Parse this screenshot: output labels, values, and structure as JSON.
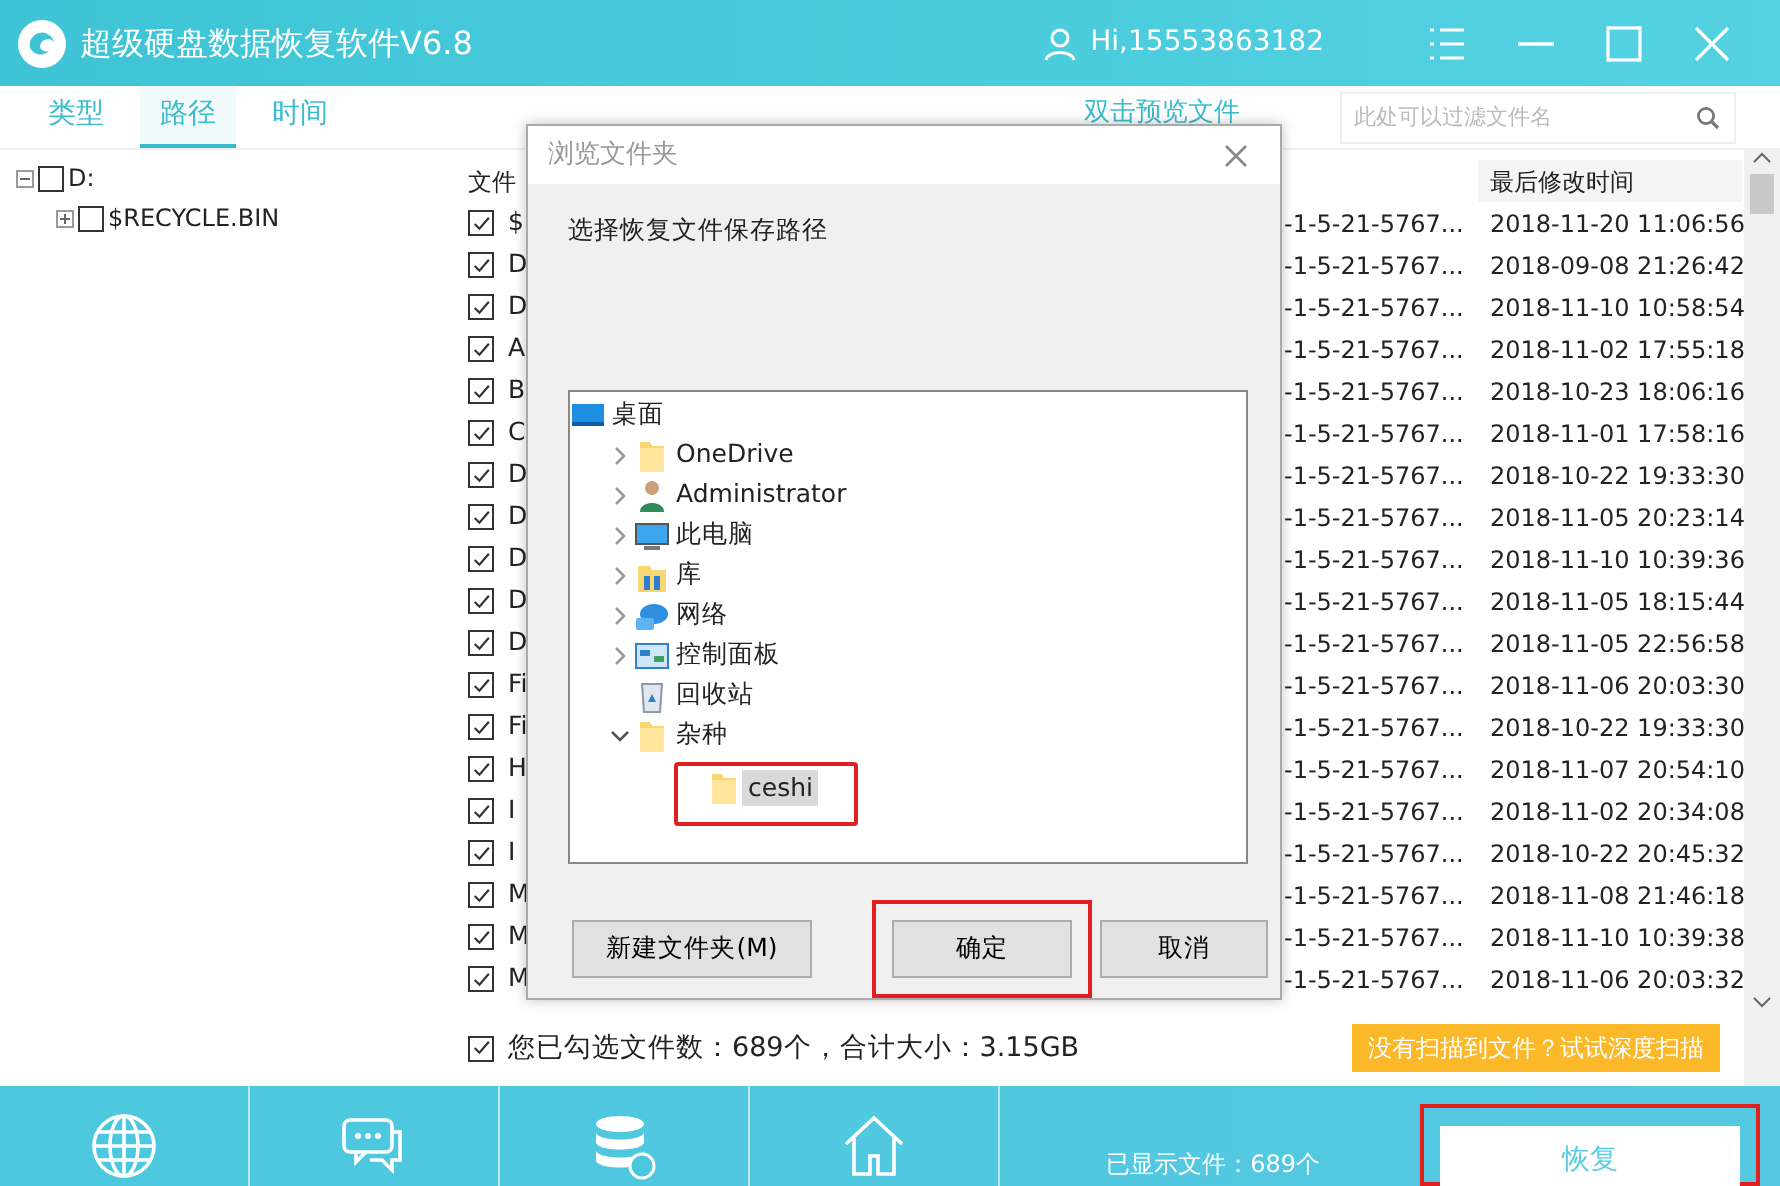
{
  "window": {
    "title": "超级硬盘数据恢复软件V6.8",
    "user": "Hi,15553863182"
  },
  "tabs": [
    {
      "label": "类型",
      "selected": false
    },
    {
      "label": "路径",
      "selected": true
    },
    {
      "label": "时间",
      "selected": false
    }
  ],
  "preview_hint": "双击预览文件",
  "search": {
    "placeholder": "此处可以过滤文件名"
  },
  "drive_tree": [
    {
      "label": "D:",
      "expanded": true,
      "checked": false,
      "children": [
        {
          "label": "$RECYCLE.BIN",
          "expanded": false,
          "checked": false
        }
      ]
    }
  ],
  "file_list": {
    "columns": [
      "文件",
      "最后修改时间"
    ],
    "rows": [
      {
        "name": "$",
        "path": "-1-5-21-5767...",
        "modified": "2018-11-20 11:06:56",
        "checked": true
      },
      {
        "name": "D",
        "path": "-1-5-21-5767...",
        "modified": "2018-09-08 21:26:42",
        "checked": true
      },
      {
        "name": "D",
        "path": "-1-5-21-5767...",
        "modified": "2018-11-10 10:58:54",
        "checked": true
      },
      {
        "name": "A",
        "path": "-1-5-21-5767...",
        "modified": "2018-11-02 17:55:18",
        "checked": true
      },
      {
        "name": "B",
        "path": "-1-5-21-5767...",
        "modified": "2018-10-23 18:06:16",
        "checked": true
      },
      {
        "name": "C",
        "path": "-1-5-21-5767...",
        "modified": "2018-11-01 17:58:16",
        "checked": true
      },
      {
        "name": "D",
        "path": "-1-5-21-5767...",
        "modified": "2018-10-22 19:33:30",
        "checked": true
      },
      {
        "name": "D",
        "path": "-1-5-21-5767...",
        "modified": "2018-11-05 20:23:14",
        "checked": true
      },
      {
        "name": "D",
        "path": "-1-5-21-5767...",
        "modified": "2018-11-10 10:39:36",
        "checked": true
      },
      {
        "name": "D",
        "path": "-1-5-21-5767...",
        "modified": "2018-11-05 18:15:44",
        "checked": true
      },
      {
        "name": "D",
        "path": "-1-5-21-5767...",
        "modified": "2018-11-05 22:56:58",
        "checked": true
      },
      {
        "name": "Fi",
        "path": "-1-5-21-5767...",
        "modified": "2018-11-06 20:03:30",
        "checked": true
      },
      {
        "name": "Fi",
        "path": "-1-5-21-5767...",
        "modified": "2018-10-22 19:33:30",
        "checked": true
      },
      {
        "name": "H",
        "path": "-1-5-21-5767...",
        "modified": "2018-11-07 20:54:10",
        "checked": true
      },
      {
        "name": "I",
        "path": "-1-5-21-5767...",
        "modified": "2018-11-02 20:34:08",
        "checked": true
      },
      {
        "name": "I",
        "path": "-1-5-21-5767...",
        "modified": "2018-10-22 20:45:32",
        "checked": true
      },
      {
        "name": "M",
        "path": "-1-5-21-5767...",
        "modified": "2018-11-08 21:46:18",
        "checked": true
      },
      {
        "name": "M",
        "path": "-1-5-21-5767...",
        "modified": "2018-11-10 10:39:38",
        "checked": true
      },
      {
        "name": "M",
        "path": "-1-5-21-5767...",
        "modified": "2018-11-06 20:03:32",
        "checked": true
      }
    ]
  },
  "summary": {
    "checked": true,
    "text": "您已勾选文件数：689个，合计大小：3.15GB"
  },
  "deep_scan_button": "没有扫描到文件？试试深度扫描",
  "footer": {
    "shown_count": "已显示文件：689个",
    "recover_button": {
      "label": "恢复",
      "highlighted": true
    }
  },
  "dialog": {
    "title": "浏览文件夹",
    "prompt": "选择恢复文件保存路径",
    "tree": [
      {
        "label": "桌面",
        "kind": "desktop",
        "selected": false,
        "children": [
          {
            "label": "OneDrive",
            "kind": "folder",
            "expanded": false,
            "selected": false
          },
          {
            "label": "Administrator",
            "kind": "user",
            "expanded": false,
            "selected": false
          },
          {
            "label": "此电脑",
            "kind": "computer",
            "expanded": false,
            "selected": false
          },
          {
            "label": "库",
            "kind": "library",
            "expanded": false,
            "selected": false
          },
          {
            "label": "网络",
            "kind": "network",
            "expanded": false,
            "selected": false
          },
          {
            "label": "控制面板",
            "kind": "control-panel",
            "expanded": false,
            "selected": false
          },
          {
            "label": "回收站",
            "kind": "recycle-bin",
            "selected": false
          },
          {
            "label": "杂种",
            "kind": "folder",
            "expanded": true,
            "selected": false,
            "children": [
              {
                "label": "ceshi",
                "kind": "folder",
                "selected": true,
                "highlighted": true
              }
            ]
          }
        ]
      }
    ],
    "buttons": [
      {
        "label": "新建文件夹(M)",
        "highlighted": false
      },
      {
        "label": "确定",
        "highlighted": true
      },
      {
        "label": "取消",
        "highlighted": false
      }
    ]
  }
}
